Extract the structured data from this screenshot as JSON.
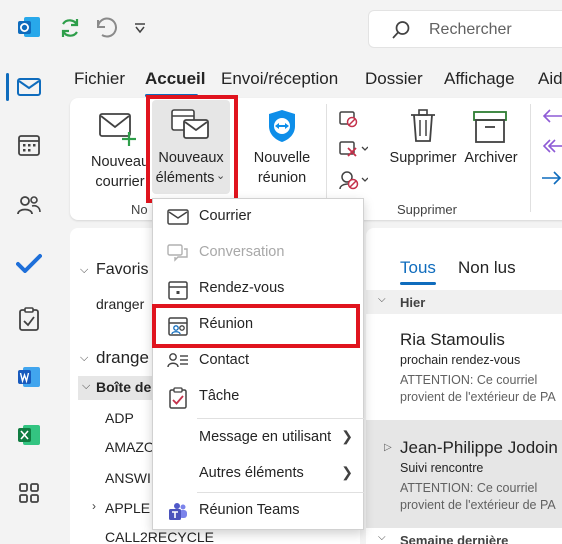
{
  "titlebar": {
    "search_placeholder": "Rechercher"
  },
  "tabs": [
    "Fichier",
    "Accueil",
    "Envoi/réception",
    "Dossier",
    "Affichage",
    "Aid"
  ],
  "ribbon": {
    "new_mail": {
      "line1": "Nouveau",
      "line2": "courrier"
    },
    "new_items": {
      "line1": "Nouveaux",
      "line2": "éléments"
    },
    "new_meeting": {
      "line1": "Nouvelle",
      "line2": "réunion"
    },
    "delete_label": "Supprimer",
    "archive_label": "Archiver",
    "group_new": "No",
    "group_delete": "Supprimer"
  },
  "folders": {
    "favorites": "Favoris",
    "fav_item": "dranger",
    "account": "drange",
    "inbox": "Boîte de",
    "items": [
      "ADP",
      "AMAZO",
      "ANSWI",
      "APPLE",
      "CALL2RECYCLE"
    ]
  },
  "messages": {
    "filter_all": "Tous",
    "filter_unread": "Non lus",
    "group_yesterday": "Hier",
    "group_lastweek": "Semaine dernière",
    "list": [
      {
        "sender": "Ria Stamoulis",
        "subject": "prochain rendez-vous",
        "preview1": "ATTENTION: Ce courriel",
        "preview2": "provient de l'extérieur de PA"
      },
      {
        "sender": "Jean-Philippe Jodoin",
        "subject": "Suivi rencontre",
        "preview1": "ATTENTION: Ce courriel",
        "preview2": "provient de l'extérieur de PA"
      }
    ]
  },
  "menu": {
    "items": [
      {
        "label": "Courrier",
        "icon": "mail-icon"
      },
      {
        "label": "Conversation",
        "icon": "conversation-icon",
        "disabled": true
      },
      {
        "label": "Rendez-vous",
        "icon": "calendar-icon"
      },
      {
        "label": "Réunion",
        "icon": "meeting-icon"
      },
      {
        "label": "Contact",
        "icon": "contact-icon"
      },
      {
        "label": "Tâche",
        "icon": "task-icon"
      },
      {
        "label": "Message en utilisant",
        "icon": "",
        "submenu": true
      },
      {
        "label": "Autres éléments",
        "icon": "",
        "submenu": true
      },
      {
        "label": "Réunion Teams",
        "icon": "teams-icon"
      }
    ]
  },
  "colors": {
    "accent": "#0f6cbd",
    "highlight": "#e0141e"
  }
}
